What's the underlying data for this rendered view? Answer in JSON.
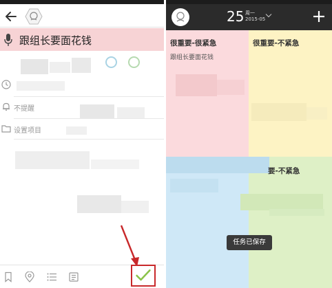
{
  "left_screen": {
    "task": {
      "title": "跟组长要面花钱"
    },
    "reminder": {
      "label": "不提醒"
    },
    "settings": {
      "label": "设置项目"
    },
    "colors": {
      "voice_bar": "#f7d3d5",
      "circle_blue": "#a9d3e4",
      "circle_green": "#b6dab0",
      "highlight": "#c8282a"
    }
  },
  "right_screen": {
    "header": {
      "day": "25",
      "weekday": "周一",
      "month": "2015-05"
    },
    "quadrants": {
      "important_urgent": {
        "label": "很重要-很紧急",
        "items": [
          "跟组长要面花钱"
        ],
        "color": "#fbdadd"
      },
      "important_not_urgent": {
        "label": "很重要-不紧急",
        "color": "#fdf3c4"
      },
      "not_important_urgent": {
        "color": "#cfe8f7"
      },
      "not_important_not_urgent": {
        "label": "要-不紧急",
        "color": "#def0c6"
      }
    },
    "toast": "任务已保存"
  }
}
